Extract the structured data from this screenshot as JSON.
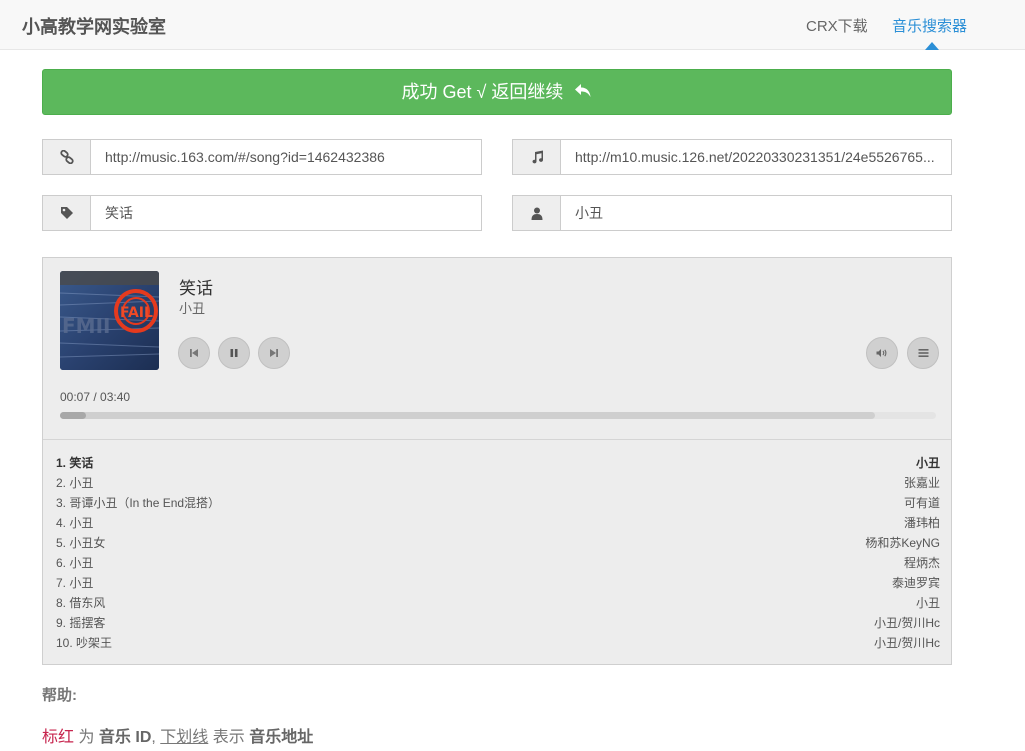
{
  "header": {
    "brand": "小高教学网实验室",
    "nav": {
      "crx": "CRX下载",
      "music": "音乐搜索器"
    },
    "active_color": "#2b8fd6"
  },
  "success_button": {
    "label": "成功 Get √ 返回继续",
    "icon": "reply-arrow-icon",
    "color": "#5cb85c"
  },
  "fields": {
    "song_url": {
      "icon": "link-icon",
      "value": "http://music.163.com/#/song?id=1462432386"
    },
    "audio_url": {
      "icon": "music-note-icon",
      "value": "http://m10.music.126.net/20220330231351/24e5526765..."
    },
    "title": {
      "icon": "tag-icon",
      "value": "笑话"
    },
    "artist": {
      "icon": "user-icon",
      "value": "小丑"
    }
  },
  "player": {
    "title": "笑话",
    "artist": "小丑",
    "time": "00:07 / 03:40",
    "progress_played": 0.03,
    "progress_loaded": 0.93,
    "controls": [
      "skip-back-icon",
      "pause-icon",
      "skip-forward-icon",
      "volume-icon",
      "menu-icon"
    ],
    "cover_icon": "album-cover"
  },
  "playlist": [
    {
      "label": "1. 笑话",
      "artist": "小丑",
      "active": true
    },
    {
      "label": "2. 小丑",
      "artist": "张嘉业"
    },
    {
      "label": "3. 哥谭小丑（In the End混搭）",
      "artist": "可有道"
    },
    {
      "label": "4. 小丑",
      "artist": "潘玮柏"
    },
    {
      "label": "5. 小丑女",
      "artist": "杨和苏KeyNG"
    },
    {
      "label": "6. 小丑",
      "artist": "程炳杰"
    },
    {
      "label": "7. 小丑",
      "artist": "泰迪罗宾"
    },
    {
      "label": "8. 借东风",
      "artist": "小丑"
    },
    {
      "label": "9. 摇摆客",
      "artist": "小丑/贺川Hc"
    },
    {
      "label": "10. 吵架王",
      "artist": "小丑/贺川Hc"
    }
  ],
  "help": {
    "title": "帮助:",
    "red": "标红",
    "t1": " 为 ",
    "b1": "音乐 ID",
    "t2": ", ",
    "u": "下划线",
    "t3": " 表示 ",
    "b2": "音乐地址"
  }
}
